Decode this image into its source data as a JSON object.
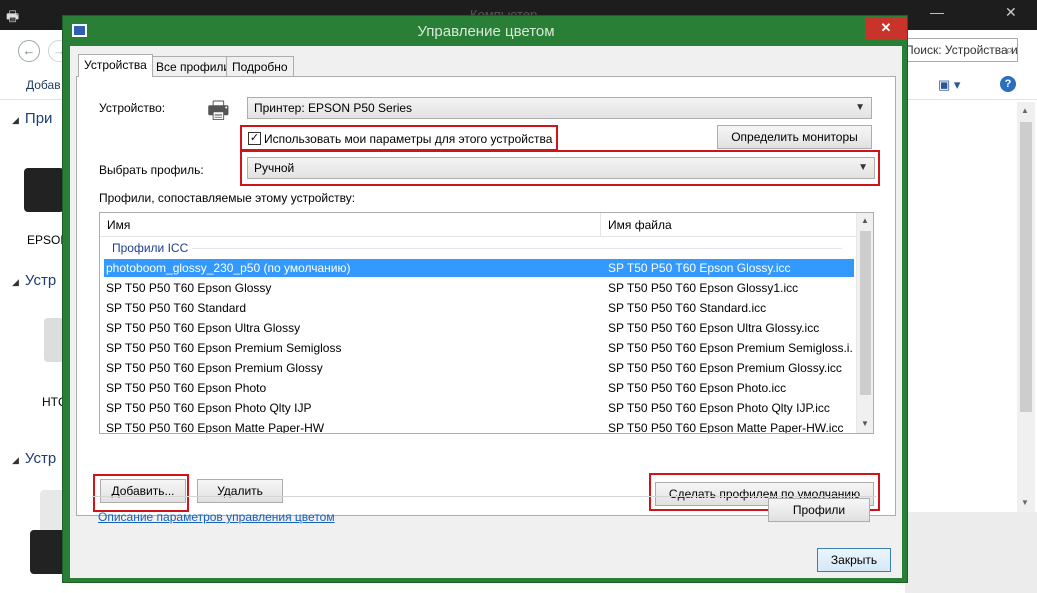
{
  "background_window": {
    "title": "Компьютер",
    "search_text": "Поиск: Устройства и принте...",
    "add_label": "Добав",
    "section1": "При",
    "section2": "Устр",
    "section3": "Устр",
    "device1_label": "EPSON",
    "device2_label": "HTC"
  },
  "dialog": {
    "title": "Управление цветом",
    "close_glyph": "✕",
    "tabs": [
      {
        "label": "Устройства",
        "active": true
      },
      {
        "label": "Все профили",
        "active": false
      },
      {
        "label": "Подробно",
        "active": false
      }
    ],
    "device_label": "Устройство:",
    "device_value": "Принтер: EPSON P50 Series",
    "use_my_settings_label": "Использовать мои параметры для этого устройства",
    "use_my_settings_checked": true,
    "identify_monitors_button": "Определить мониторы",
    "select_profile_label": "Выбрать профиль:",
    "select_profile_value": "Ручной",
    "profiles_caption": "Профили, сопоставляемые этому устройству:",
    "list": {
      "col_name": "Имя",
      "col_file": "Имя файла",
      "group": "Профили ICC",
      "rows": [
        {
          "name": "photoboom_glossy_230_p50 (по умолчанию)",
          "file": "SP T50 P50 T60 Epson Glossy.icc",
          "selected": true
        },
        {
          "name": "SP T50 P50 T60 Epson Glossy",
          "file": "SP T50 P50 T60 Epson Glossy1.icc",
          "selected": false
        },
        {
          "name": "SP T50 P50 T60 Standard",
          "file": "SP T50 P50 T60 Standard.icc",
          "selected": false
        },
        {
          "name": "SP T50 P50 T60 Epson Ultra Glossy",
          "file": "SP T50 P50 T60 Epson Ultra Glossy.icc",
          "selected": false
        },
        {
          "name": "SP T50 P50 T60 Epson Premium Semigloss",
          "file": "SP T50 P50 T60 Epson Premium Semigloss.i...",
          "selected": false
        },
        {
          "name": "SP T50 P50 T60 Epson Premium Glossy",
          "file": "SP T50 P50 T60 Epson Premium Glossy.icc",
          "selected": false
        },
        {
          "name": "SP T50 P50 T60 Epson Photo",
          "file": "SP T50 P50 T60 Epson Photo.icc",
          "selected": false
        },
        {
          "name": "SP T50 P50 T60 Epson Photo Qlty IJP",
          "file": "SP T50 P50 T60 Epson Photo Qlty IJP.icc",
          "selected": false
        },
        {
          "name": "SP T50 P50 T60 Epson Matte Paper-HW",
          "file": "SP T50 P50 T60 Epson Matte Paper-HW.icc",
          "selected": false
        }
      ]
    },
    "add_button": "Добавить...",
    "remove_button": "Удалить",
    "set_default_button": "Сделать профилем по умолчанию",
    "help_link": "Описание параметров управления цветом",
    "profiles_button": "Профили",
    "close_button": "Закрыть"
  },
  "colors": {
    "dialog_frame": "#2a7f36",
    "highlight_box": "#d0141c",
    "selection": "#3399ff",
    "close_button_red": "#c8342a"
  }
}
